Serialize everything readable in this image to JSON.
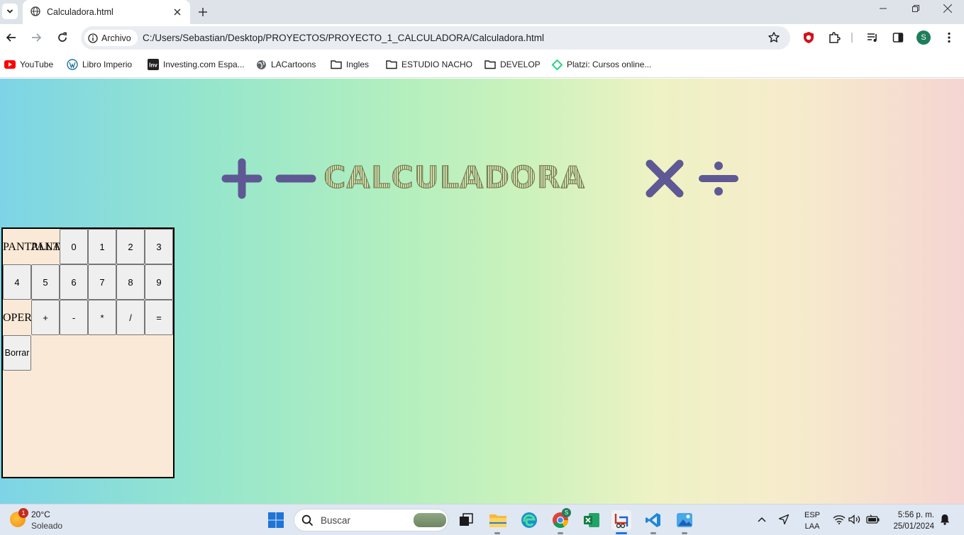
{
  "tab": {
    "title": "Calculadora.html",
    "favicon": "globe-icon"
  },
  "omnibox": {
    "chip_label": "Archivo",
    "url": "C:/Users/Sebastian/Desktop/PROYECTOS/PROYECTO_1_CALCULADORA/Calculadora.html"
  },
  "profile": {
    "initial": "S",
    "color": "#1e7e5a"
  },
  "bookmarks": [
    {
      "label": "YouTube",
      "icon": "youtube-icon"
    },
    {
      "label": "Libro Imperio",
      "icon": "wordpress-icon"
    },
    {
      "label": "Investing.com Espa...",
      "icon": "investing-icon"
    },
    {
      "label": "LACartoons",
      "icon": "globe-icon"
    },
    {
      "label": "Ingles",
      "icon": "folder-icon"
    },
    {
      "label": "ESTUDIO NACHO",
      "icon": "folder-icon"
    },
    {
      "label": "DEVELOP",
      "icon": "folder-icon"
    },
    {
      "label": "Platzi: Cursos online...",
      "icon": "platzi-icon"
    }
  ],
  "page": {
    "banner": {
      "plus": "+",
      "minus": "−",
      "title": "CALCULADORA",
      "times": "×",
      "divide": "÷",
      "color": "#5e5894"
    },
    "calculator": {
      "pantalla_label": "PANTALLA",
      "oper_label": "OPER",
      "digits": [
        "0",
        "1",
        "2",
        "3",
        "4",
        "5",
        "6",
        "7",
        "8",
        "9"
      ],
      "operators": [
        "+",
        "-",
        "*",
        "/",
        "="
      ],
      "clear_label": "Borrar"
    }
  },
  "taskbar": {
    "weather": {
      "temp": "20°C",
      "condition": "Soleado",
      "badge": "1"
    },
    "search_placeholder": "Buscar",
    "lang": {
      "line1": "ESP",
      "line2": "LAA"
    },
    "clock": {
      "time": "5:56 p. m.",
      "date": "25/01/2024"
    }
  }
}
